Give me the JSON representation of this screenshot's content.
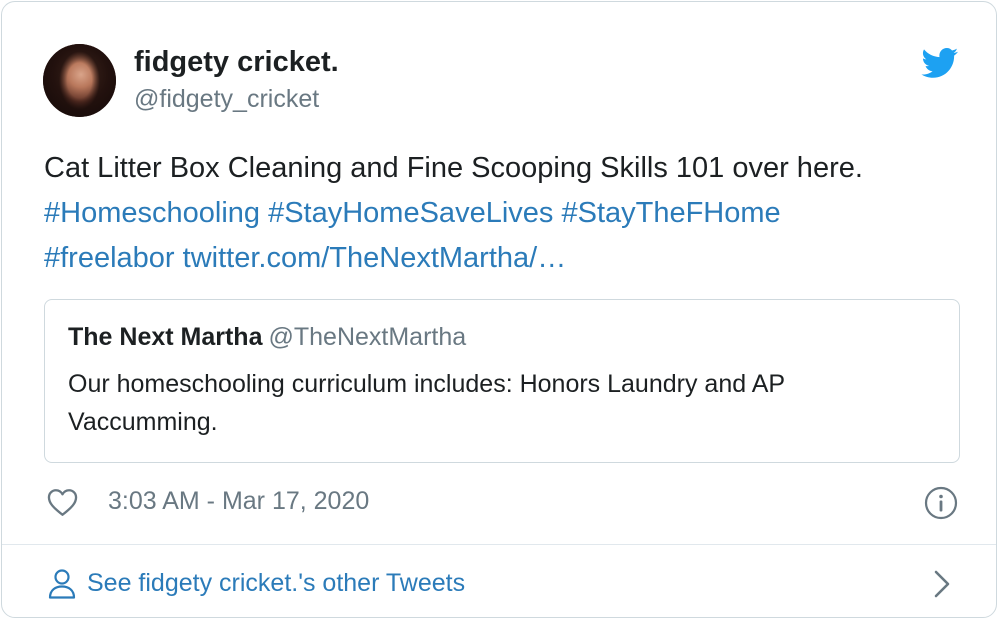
{
  "author": {
    "name": "fidgety cricket.",
    "handle": "@fidgety_cricket"
  },
  "icons": {
    "avatar": "profile-photo",
    "brand": "twitter-bird-icon",
    "like": "heart-icon",
    "info": "info-icon",
    "profile": "person-icon",
    "more": "chevron-right-icon"
  },
  "tweet": {
    "text_line1": "Cat Litter Box Cleaning and Fine Scooping Skills 101 over here.",
    "hashtags": [
      "#Homeschooling",
      "#StayHomeSaveLives",
      "#StayTheFHome",
      "#freelabor"
    ],
    "link": "twitter.com/TheNextMartha/…"
  },
  "quoted_tweet": {
    "name": "The Next Martha",
    "handle": "@TheNextMartha",
    "text": "Our homeschooling curriculum includes: Honors Laundry and AP Vaccumming."
  },
  "meta": {
    "timestamp": "3:03 AM - Mar 17, 2020"
  },
  "footer": {
    "label": "See fidgety cricket.'s other Tweets"
  },
  "colors": {
    "link": "#2b7bb9",
    "brand": "#1da1f2",
    "text": "#1c2022",
    "muted": "#697882",
    "border": "#cfd9de"
  }
}
